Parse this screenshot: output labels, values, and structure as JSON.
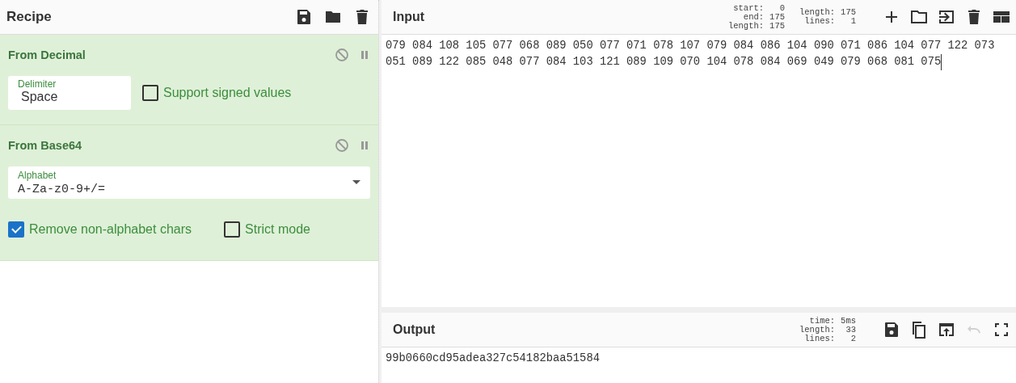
{
  "recipe": {
    "title": "Recipe",
    "tools": [
      {
        "kind": "save"
      },
      {
        "kind": "folder"
      },
      {
        "kind": "trash"
      }
    ],
    "operations": [
      {
        "name": "From Decimal",
        "args": [
          {
            "kind": "text",
            "label": "Delimiter",
            "value": "Space"
          },
          {
            "kind": "checkbox",
            "label": "Support signed values",
            "checked": false
          }
        ]
      },
      {
        "name": "From Base64",
        "args": [
          {
            "kind": "select",
            "label": "Alphabet",
            "value": "A-Za-z0-9+/="
          },
          {
            "kind": "checkbox",
            "label": "Remove non-alphabet chars",
            "checked": true
          },
          {
            "kind": "checkbox",
            "label": "Strict mode",
            "checked": false
          }
        ]
      }
    ]
  },
  "input": {
    "title": "Input",
    "stats": [
      [
        {
          "label": "start:",
          "value": "0"
        },
        {
          "label": "end:",
          "value": "175"
        },
        {
          "label": "length:",
          "value": "175"
        }
      ],
      [
        {
          "label": "length:",
          "value": "175"
        },
        {
          "label": "lines:",
          "value": "1"
        }
      ]
    ],
    "tools": [
      {
        "kind": "add",
        "disabled": false
      },
      {
        "kind": "folder-outline",
        "disabled": false
      },
      {
        "kind": "import",
        "disabled": false
      },
      {
        "kind": "trash",
        "disabled": false
      },
      {
        "kind": "layout",
        "disabled": false
      }
    ],
    "lines": [
      "079 084 108 105 077 068 089 050 077 071 078 107 079 084 086 104 090 071 086 104 077 122 073",
      "051 089 122 085 048 077 084 103 121 089 109 070 104 078 084 069 049 079 068 081 075"
    ]
  },
  "output": {
    "title": "Output",
    "stats": [
      [
        {
          "label": "time:",
          "value": "5ms"
        },
        {
          "label": "length:",
          "value": "33"
        },
        {
          "label": "lines:",
          "value": "2"
        }
      ]
    ],
    "tools": [
      {
        "kind": "save",
        "disabled": false
      },
      {
        "kind": "copy",
        "disabled": false
      },
      {
        "kind": "replace",
        "disabled": false
      },
      {
        "kind": "undo",
        "disabled": true
      },
      {
        "kind": "fullscreen",
        "disabled": false
      }
    ],
    "lines": [
      "99b0660cd95adea327c54182baa51584"
    ]
  }
}
